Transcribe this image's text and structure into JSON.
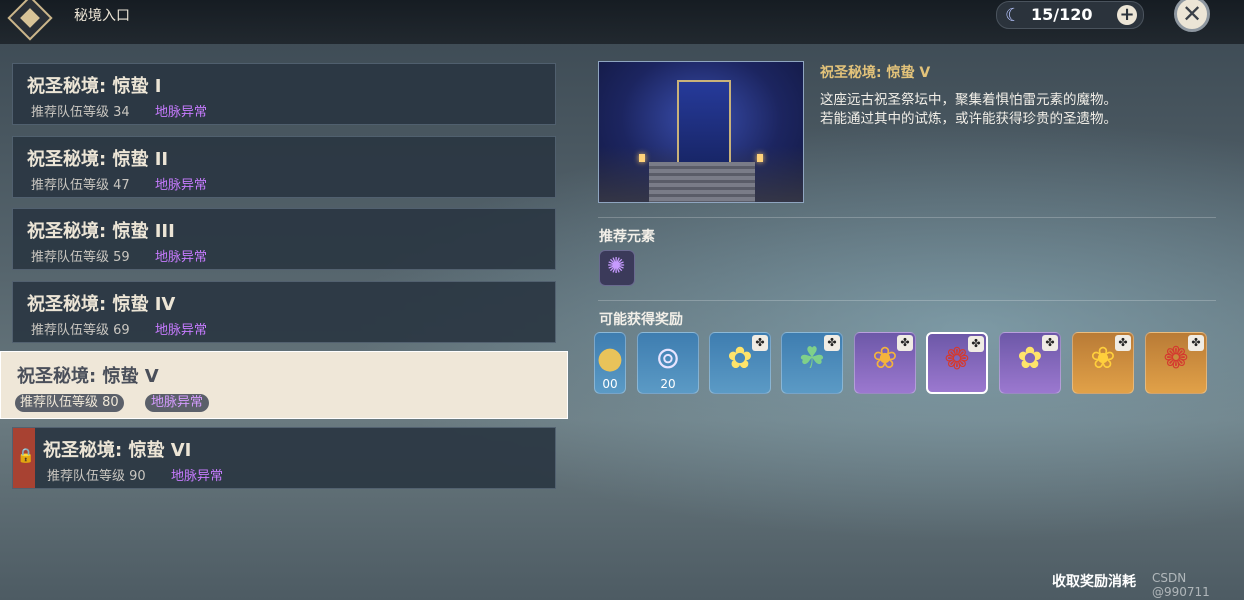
{
  "header": {
    "title": "秘境入口",
    "resin_value": "15/120",
    "resin_icon": "crescent-moon-icon",
    "add_icon": "plus-icon",
    "close_icon": "close-icon"
  },
  "domains": [
    {
      "name": "祝圣秘境: 惊蛰 I",
      "level": "推荐队伍等级 34",
      "tag": "地脉异常",
      "state": "normal"
    },
    {
      "name": "祝圣秘境: 惊蛰 II",
      "level": "推荐队伍等级 47",
      "tag": "地脉异常",
      "state": "normal"
    },
    {
      "name": "祝圣秘境: 惊蛰 III",
      "level": "推荐队伍等级 59",
      "tag": "地脉异常",
      "state": "normal"
    },
    {
      "name": "祝圣秘境: 惊蛰 IV",
      "level": "推荐队伍等级 69",
      "tag": "地脉异常",
      "state": "normal"
    },
    {
      "name": "祝圣秘境: 惊蛰 V",
      "level": "推荐队伍等级 80",
      "tag": "地脉异常",
      "state": "selected"
    },
    {
      "name": "祝圣秘境: 惊蛰 VI",
      "level": "推荐队伍等级 90",
      "tag": "地脉异常",
      "state": "locked"
    }
  ],
  "detail": {
    "title": "祝圣秘境: 惊蛰 V",
    "desc_line1": "这座远古祝圣祭坛中，聚集着惧怕雷元素的魔物。",
    "desc_line2": "若能通过其中的试炼，或许能获得珍贵的圣遗物。",
    "recommended_label": "推荐元素",
    "recommended_element_icon": "electro-element-icon",
    "rewards_label": "可能获得奖励"
  },
  "rewards": [
    {
      "icon": "mora-coin-icon",
      "count": "00",
      "rarity": "blue"
    },
    {
      "icon": "companionship-exp-icon",
      "count": "20",
      "rarity": "blue"
    },
    {
      "icon": "yellow-flower-artifact-icon",
      "count": "",
      "rarity": "blue"
    },
    {
      "icon": "clover-artifact-icon",
      "count": "",
      "rarity": "blue"
    },
    {
      "icon": "gold-flower-artifact-icon",
      "count": "",
      "rarity": "purple"
    },
    {
      "icon": "red-flower-artifact-icon",
      "count": "",
      "rarity": "purple"
    },
    {
      "icon": "yellow-flower-artifact-icon",
      "count": "",
      "rarity": "purple"
    },
    {
      "icon": "gold-flower-artifact-icon",
      "count": "",
      "rarity": "gold"
    },
    {
      "icon": "red-flower-artifact-icon",
      "count": "",
      "rarity": "gold"
    }
  ],
  "footer": {
    "cost_label": "收取奖励消耗",
    "watermark": "CSDN @990711"
  }
}
